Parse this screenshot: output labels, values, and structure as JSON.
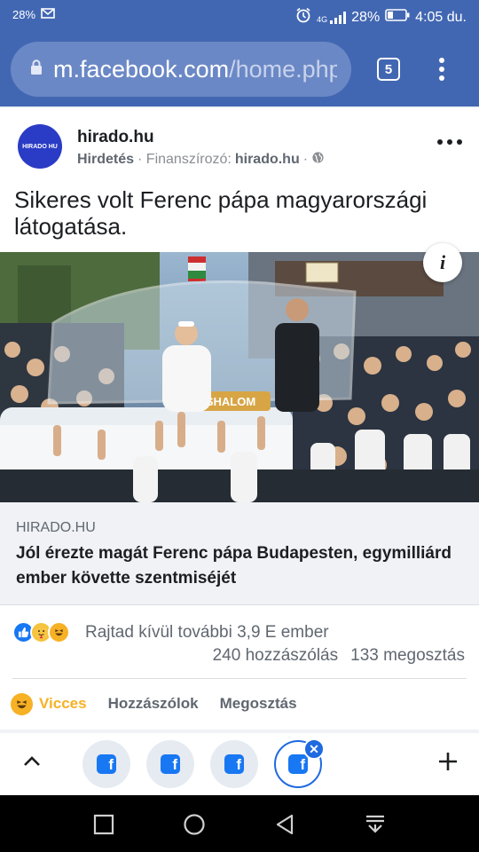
{
  "status_bar": {
    "battery_small": "28%",
    "network": "4G",
    "battery": "28%",
    "time": "4:05 du."
  },
  "browser": {
    "url_host": "m.facebook.com",
    "url_path": "/home.php",
    "tab_count": "5"
  },
  "post": {
    "avatar_text": "HIRADO HU",
    "page_name": "hirado.hu",
    "sponsored_label": "Hirdetés",
    "sponsor_prefix": "· Finanszírozó:",
    "sponsor_name": "hirado.hu",
    "sponsor_suffix": "·",
    "text": "Sikeres volt Ferenc pápa magyarországi látogatása.",
    "image_sign": "SHALOM",
    "link": {
      "domain": "HIRADO.HU",
      "title": "Jól érezte magát Ferenc pápa Budapesten, egymilliárd ember követte szentmiséjét"
    },
    "reactions_text": "Rajtad kívül további 3,9 E ember",
    "comments_count": "240 hozzászólás",
    "shares_count": "133 megosztás",
    "actions": {
      "funny": "Vicces",
      "comment": "Hozzászólok",
      "share": "Megosztás"
    }
  },
  "tab_bubbles": [
    "facebook-tab",
    "facebook-tab",
    "facebook-tab",
    "facebook-tab-active"
  ],
  "colors": {
    "facebook_blue": "#4267b2",
    "brand_blue": "#1877f2",
    "funny_yellow": "#f7b125"
  }
}
